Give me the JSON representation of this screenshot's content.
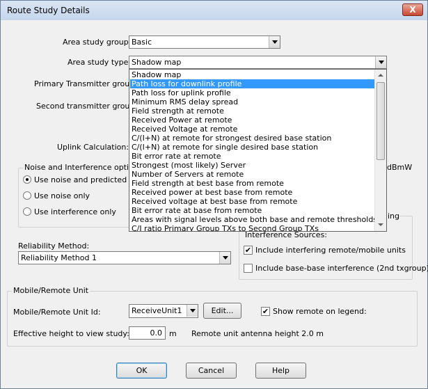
{
  "window": {
    "title": "Route Study Details",
    "close_label": "X"
  },
  "form": {
    "area_study_group_label": "Area study group:",
    "area_study_group_value": "Basic",
    "area_study_type_label": "Area study type:",
    "area_study_type_value": "Shadow map",
    "primary_tx_label": "Primary Transmitter group:",
    "second_tx_label": "Second transmitter group:",
    "uplink_label": "Uplink Calculation:",
    "dbmw_label": "dBmW"
  },
  "dropdown": {
    "items": [
      "Shadow map",
      "Path loss for downlink profile",
      "Path loss for uplink profile",
      "Minimum RMS delay spread",
      "Field strength at remote",
      "Received Power at remote",
      "Received Voltage at remote",
      "C/(I+N) at remote for strongest desired base station",
      "C/(I+N) at remote for single desired base station",
      "Bit error rate at remote",
      "Strongest (most likely) Server",
      "Number of Servers at remote",
      "Field strength at best base from remote",
      "Received power at best base from remote",
      "Received voltage at best base from remote",
      "Bit error rate at base from remote",
      "Areas with signal levels above both base and remote thresholds",
      "C/I ratio Primary Group TXs to Second Group TXs"
    ],
    "selected_index": 1
  },
  "noise_group": {
    "title": "Noise and Interference options",
    "options": [
      "Use noise and predicted inte",
      "Use noise only",
      "Use interference only"
    ],
    "selected_index": 0
  },
  "interference_group": {
    "title_fragment": "ing",
    "sources_label": "Interference Sources:",
    "include_remote_label": "Include interfering remote/mobile units",
    "include_remote_checked": true,
    "include_base_label": "Include base-base interference (2nd txgroup)",
    "include_base_checked": false
  },
  "reliability": {
    "label": "Reliability Method:",
    "value": "Reliability Method 1"
  },
  "mobile_group": {
    "title": "Mobile/Remote Unit",
    "unit_id_label": "Mobile/Remote Unit Id:",
    "unit_id_value": "ReceiveUnit1",
    "edit_label": "Edit...",
    "show_remote_label": "Show remote on legend:",
    "show_remote_checked": true,
    "eff_height_label": "Effective height to view study:",
    "eff_height_value": "0.0",
    "eff_height_unit": "m",
    "antenna_height_text": "Remote unit antenna height 2.0 m"
  },
  "buttons": {
    "ok": "OK",
    "cancel": "Cancel",
    "help": "Help"
  },
  "colors": {
    "selection": "#3399ff",
    "titlebar": "#c5d6ec",
    "close": "#c8482f"
  },
  "icons": {
    "check": "✔",
    "close": "X"
  }
}
